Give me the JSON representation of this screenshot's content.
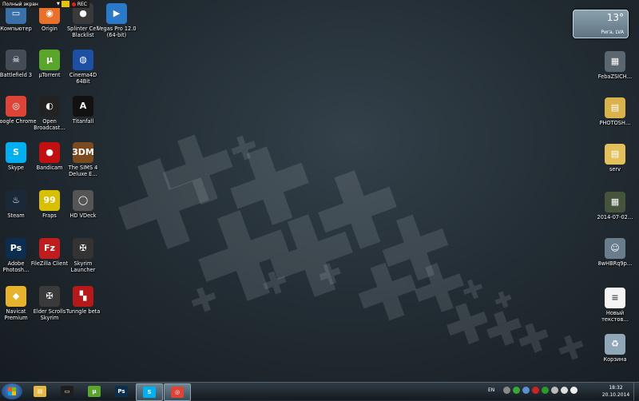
{
  "recorder": {
    "mode": "Полный экран",
    "dropdown": "▼",
    "rec": "REC"
  },
  "weather": {
    "temperature": "13°",
    "location": "Рига, LVA"
  },
  "icons_left": [
    {
      "label": "Компьютер",
      "glyph": "▭",
      "color": "#3b6fa8"
    },
    {
      "label": "Origin",
      "glyph": "◉",
      "color": "#e8702a"
    },
    {
      "label": "Splinter Cell Blacklist",
      "glyph": "●",
      "color": "#3a3a3a"
    },
    {
      "label": "Vegas Pro 12.0 (64-bit)",
      "glyph": "▶",
      "color": "#2b79c9"
    },
    {
      "label": "Battlefield 3",
      "glyph": "☠",
      "color": "#444c55"
    },
    {
      "label": "µTorrent",
      "glyph": "µ",
      "color": "#5aa52c"
    },
    {
      "label": "Cinema4D 64Bit",
      "glyph": "◍",
      "color": "#1d4fa3"
    },
    {
      "label": "Google Chrome",
      "glyph": "◎",
      "color": "#db4437"
    },
    {
      "label": "Open Broadcast…",
      "glyph": "◐",
      "color": "#222"
    },
    {
      "label": "Titanfall",
      "glyph": "A",
      "color": "#111"
    },
    {
      "label": "Skype",
      "glyph": "S",
      "color": "#00aff0"
    },
    {
      "label": "Bandicam",
      "glyph": "●",
      "color": "#c21010"
    },
    {
      "label": "The SIMS 4 Deluxe E…",
      "glyph": "3DM",
      "color": "#7a4b1e"
    },
    {
      "label": "Steam",
      "glyph": "♨",
      "color": "#1b2838"
    },
    {
      "label": "Fraps",
      "glyph": "99",
      "color": "#d8c000"
    },
    {
      "label": "HD VDeck",
      "glyph": "◯",
      "color": "#555"
    },
    {
      "label": "Adobe Photosh…",
      "glyph": "Ps",
      "color": "#0b2d4e"
    },
    {
      "label": "FileZilla Client",
      "glyph": "Fz",
      "color": "#bf1d1d"
    },
    {
      "label": "Skyrim Launcher",
      "glyph": "✠",
      "color": "#333"
    },
    {
      "label": "Navicat Premium",
      "glyph": "◆",
      "color": "#e8b32c"
    },
    {
      "label": "Elder Scrolls Skyrim",
      "glyph": "✠",
      "color": "#3a3a3a"
    },
    {
      "label": "Tunngle beta",
      "glyph": "▚",
      "color": "#b51919"
    }
  ],
  "icons_right": [
    {
      "label": "FebaZSICH…",
      "glyph": "▦",
      "color": "#5a6770"
    },
    {
      "label": "PHOTOSH…",
      "glyph": "▤",
      "color": "#d9b24c"
    },
    {
      "label": "serv",
      "glyph": "▤",
      "color": "#e2c15c"
    },
    {
      "label": "2014-07-02…",
      "glyph": "▦",
      "color": "#47543c"
    },
    {
      "label": "8wHBRq9p…",
      "glyph": "☺",
      "color": "#6a7d8c"
    },
    {
      "label": "Новый текстов…",
      "glyph": "≡",
      "color": "#f4f4f4"
    },
    {
      "label": "Корзина",
      "glyph": "♻",
      "color": "#8fa7b7"
    }
  ],
  "taskbar": {
    "apps": [
      {
        "name": "explorer",
        "glyph": "▤",
        "color": "#e3b844"
      },
      {
        "name": "console",
        "glyph": "▭",
        "color": "#1e1e1e"
      },
      {
        "name": "utorrent",
        "glyph": "µ",
        "color": "#5aa52c"
      },
      {
        "name": "photoshop",
        "glyph": "Ps",
        "color": "#0b2d4e"
      },
      {
        "name": "skype",
        "glyph": "S",
        "color": "#00aff0"
      },
      {
        "name": "chrome",
        "glyph": "◎",
        "color": "#db4437"
      }
    ],
    "lang": "EN",
    "time": "18:32",
    "date": "20.10.2014"
  }
}
